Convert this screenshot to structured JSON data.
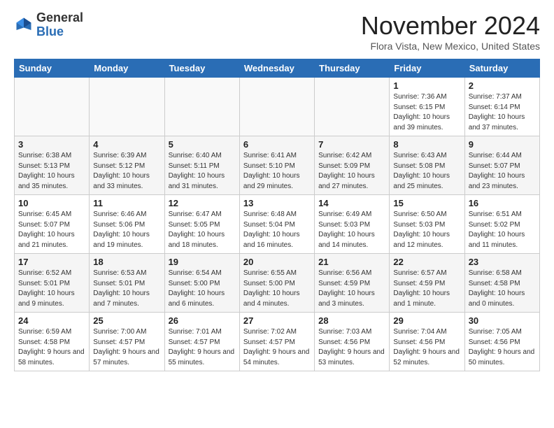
{
  "logo": {
    "general": "General",
    "blue": "Blue"
  },
  "header": {
    "month": "November 2024",
    "location": "Flora Vista, New Mexico, United States"
  },
  "weekdays": [
    "Sunday",
    "Monday",
    "Tuesday",
    "Wednesday",
    "Thursday",
    "Friday",
    "Saturday"
  ],
  "weeks": [
    [
      {
        "day": "",
        "info": ""
      },
      {
        "day": "",
        "info": ""
      },
      {
        "day": "",
        "info": ""
      },
      {
        "day": "",
        "info": ""
      },
      {
        "day": "",
        "info": ""
      },
      {
        "day": "1",
        "info": "Sunrise: 7:36 AM\nSunset: 6:15 PM\nDaylight: 10 hours and 39 minutes."
      },
      {
        "day": "2",
        "info": "Sunrise: 7:37 AM\nSunset: 6:14 PM\nDaylight: 10 hours and 37 minutes."
      }
    ],
    [
      {
        "day": "3",
        "info": "Sunrise: 6:38 AM\nSunset: 5:13 PM\nDaylight: 10 hours and 35 minutes."
      },
      {
        "day": "4",
        "info": "Sunrise: 6:39 AM\nSunset: 5:12 PM\nDaylight: 10 hours and 33 minutes."
      },
      {
        "day": "5",
        "info": "Sunrise: 6:40 AM\nSunset: 5:11 PM\nDaylight: 10 hours and 31 minutes."
      },
      {
        "day": "6",
        "info": "Sunrise: 6:41 AM\nSunset: 5:10 PM\nDaylight: 10 hours and 29 minutes."
      },
      {
        "day": "7",
        "info": "Sunrise: 6:42 AM\nSunset: 5:09 PM\nDaylight: 10 hours and 27 minutes."
      },
      {
        "day": "8",
        "info": "Sunrise: 6:43 AM\nSunset: 5:08 PM\nDaylight: 10 hours and 25 minutes."
      },
      {
        "day": "9",
        "info": "Sunrise: 6:44 AM\nSunset: 5:07 PM\nDaylight: 10 hours and 23 minutes."
      }
    ],
    [
      {
        "day": "10",
        "info": "Sunrise: 6:45 AM\nSunset: 5:07 PM\nDaylight: 10 hours and 21 minutes."
      },
      {
        "day": "11",
        "info": "Sunrise: 6:46 AM\nSunset: 5:06 PM\nDaylight: 10 hours and 19 minutes."
      },
      {
        "day": "12",
        "info": "Sunrise: 6:47 AM\nSunset: 5:05 PM\nDaylight: 10 hours and 18 minutes."
      },
      {
        "day": "13",
        "info": "Sunrise: 6:48 AM\nSunset: 5:04 PM\nDaylight: 10 hours and 16 minutes."
      },
      {
        "day": "14",
        "info": "Sunrise: 6:49 AM\nSunset: 5:03 PM\nDaylight: 10 hours and 14 minutes."
      },
      {
        "day": "15",
        "info": "Sunrise: 6:50 AM\nSunset: 5:03 PM\nDaylight: 10 hours and 12 minutes."
      },
      {
        "day": "16",
        "info": "Sunrise: 6:51 AM\nSunset: 5:02 PM\nDaylight: 10 hours and 11 minutes."
      }
    ],
    [
      {
        "day": "17",
        "info": "Sunrise: 6:52 AM\nSunset: 5:01 PM\nDaylight: 10 hours and 9 minutes."
      },
      {
        "day": "18",
        "info": "Sunrise: 6:53 AM\nSunset: 5:01 PM\nDaylight: 10 hours and 7 minutes."
      },
      {
        "day": "19",
        "info": "Sunrise: 6:54 AM\nSunset: 5:00 PM\nDaylight: 10 hours and 6 minutes."
      },
      {
        "day": "20",
        "info": "Sunrise: 6:55 AM\nSunset: 5:00 PM\nDaylight: 10 hours and 4 minutes."
      },
      {
        "day": "21",
        "info": "Sunrise: 6:56 AM\nSunset: 4:59 PM\nDaylight: 10 hours and 3 minutes."
      },
      {
        "day": "22",
        "info": "Sunrise: 6:57 AM\nSunset: 4:59 PM\nDaylight: 10 hours and 1 minute."
      },
      {
        "day": "23",
        "info": "Sunrise: 6:58 AM\nSunset: 4:58 PM\nDaylight: 10 hours and 0 minutes."
      }
    ],
    [
      {
        "day": "24",
        "info": "Sunrise: 6:59 AM\nSunset: 4:58 PM\nDaylight: 9 hours and 58 minutes."
      },
      {
        "day": "25",
        "info": "Sunrise: 7:00 AM\nSunset: 4:57 PM\nDaylight: 9 hours and 57 minutes."
      },
      {
        "day": "26",
        "info": "Sunrise: 7:01 AM\nSunset: 4:57 PM\nDaylight: 9 hours and 55 minutes."
      },
      {
        "day": "27",
        "info": "Sunrise: 7:02 AM\nSunset: 4:57 PM\nDaylight: 9 hours and 54 minutes."
      },
      {
        "day": "28",
        "info": "Sunrise: 7:03 AM\nSunset: 4:56 PM\nDaylight: 9 hours and 53 minutes."
      },
      {
        "day": "29",
        "info": "Sunrise: 7:04 AM\nSunset: 4:56 PM\nDaylight: 9 hours and 52 minutes."
      },
      {
        "day": "30",
        "info": "Sunrise: 7:05 AM\nSunset: 4:56 PM\nDaylight: 9 hours and 50 minutes."
      }
    ]
  ]
}
